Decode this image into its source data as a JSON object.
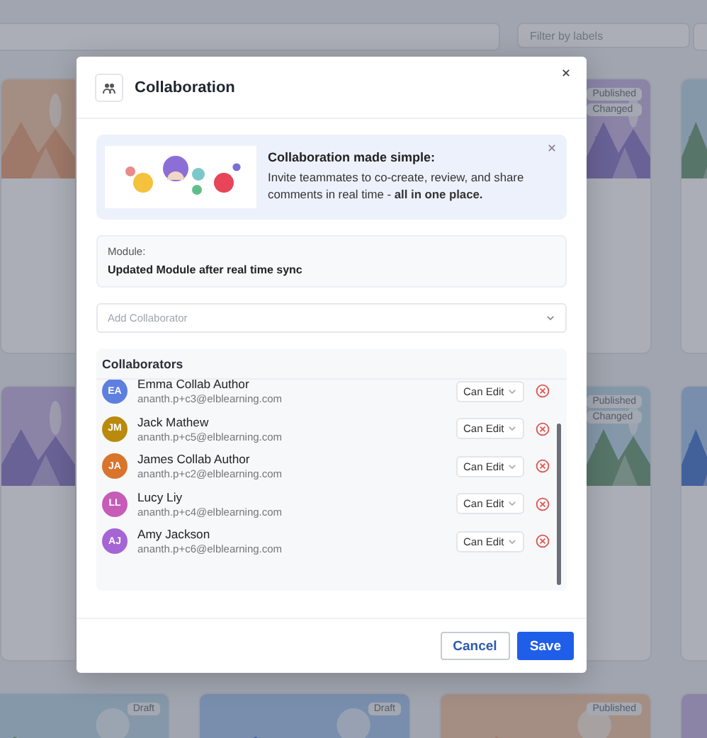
{
  "background": {
    "filter": {
      "placeholder": "Filter by labels"
    },
    "rows": [
      {
        "kind": "covered",
        "cards": [
          {
            "kind": "picture"
          },
          {
            "kind": "picture",
            "badges": [
              "Published",
              "Changed"
            ]
          },
          {
            "kind": "picture"
          }
        ]
      },
      {
        "kind": "covered",
        "cards": [
          {
            "kind": "picture"
          },
          {
            "kind": "picture",
            "badges": [
              "Published",
              "Changed"
            ]
          },
          {
            "kind": "picture"
          }
        ]
      },
      {
        "kind": "full",
        "cards": [
          {
            "kind": "picture",
            "badges": [
              "Draft"
            ]
          },
          {
            "kind": "picture",
            "badges": [
              "Draft"
            ]
          },
          {
            "kind": "picture",
            "badges": [
              "Published"
            ]
          },
          {
            "kind": "picture"
          }
        ]
      }
    ]
  },
  "dialog": {
    "title": "Collaboration",
    "banner": {
      "heading": "Collaboration made simple:",
      "text": "Invite teammates to co-create, review, and share comments in real time - **all in one place.**"
    },
    "module": {
      "label": "Module:",
      "value": "Updated Module after real time sync"
    },
    "add_collaborator": {
      "placeholder": "Add Collaborator"
    },
    "collaborators": {
      "heading": "Collaborators",
      "items": [
        {
          "initials": "EA",
          "name": "Emma Collab Author",
          "email": "ananth.p+c3@elblearning.com",
          "color": "#5d7fe0",
          "role": "Can Edit"
        },
        {
          "initials": "JM",
          "name": "Jack Mathew",
          "email": "ananth.p+c5@elblearning.com",
          "color": "#b98a0c",
          "role": "Can Edit"
        },
        {
          "initials": "JA",
          "name": "James Collab Author",
          "email": "ananth.p+c2@elblearning.com",
          "color": "#d9742c",
          "role": "Can Edit"
        },
        {
          "initials": "LL",
          "name": "Lucy Liy",
          "email": "ananth.p+c4@elblearning.com",
          "color": "#c65cb8",
          "role": "Can Edit"
        },
        {
          "initials": "AJ",
          "name": "Amy Jackson",
          "email": "ananth.p+c6@elblearning.com",
          "color": "#a565d4",
          "role": "Can Edit"
        }
      ]
    },
    "buttons": [
      {
        "label": "Cancel",
        "kind": "secondary"
      },
      {
        "label": "Save",
        "kind": "primary"
      }
    ]
  }
}
